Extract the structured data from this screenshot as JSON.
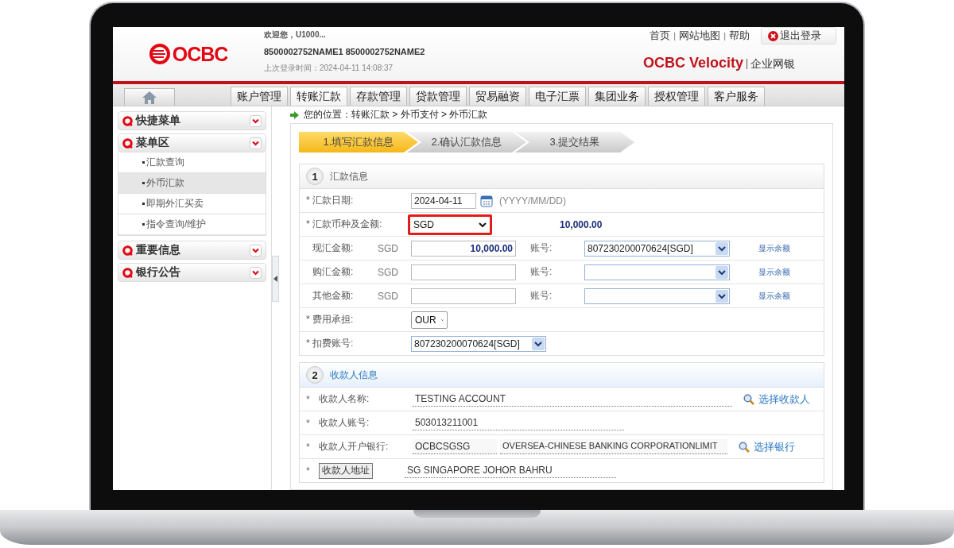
{
  "header": {
    "logo": "OCBC",
    "welcome": "欢迎您，U1000...",
    "names": "8500002752NAME1 8500002752NAME2",
    "last_login": "上次登录时间：2024-04-11 14:08:37",
    "top_links": [
      "首页",
      "网站地图",
      "帮助"
    ],
    "separator": "|",
    "logout": "退出登录",
    "brand": "OCBC Velocity",
    "brand_sub": "企业网银"
  },
  "nav": {
    "tabs": [
      {
        "label": "账户管理",
        "selected": false
      },
      {
        "label": "转账汇款",
        "selected": true
      },
      {
        "label": "存款管理",
        "selected": false
      },
      {
        "label": "贷款管理",
        "selected": false
      },
      {
        "label": "贸易融资",
        "selected": false
      },
      {
        "label": "电子汇票",
        "selected": false
      },
      {
        "label": "集团业务",
        "selected": false
      },
      {
        "label": "授权管理",
        "selected": false
      },
      {
        "label": "客户服务",
        "selected": false
      }
    ]
  },
  "sidebar": {
    "sections": [
      {
        "title": "快捷菜单"
      },
      {
        "title": "菜单区",
        "items": [
          {
            "label": "汇款查询",
            "selected": false
          },
          {
            "label": "外币汇款",
            "selected": true
          },
          {
            "label": "即期外汇买卖",
            "selected": false
          },
          {
            "label": "指令查询/维护",
            "selected": false
          }
        ]
      },
      {
        "title": "重要信息"
      },
      {
        "title": "银行公告"
      }
    ]
  },
  "breadcrumb": "您的位置：转账汇款 > 外币支付 > 外币汇款",
  "steps": [
    {
      "label": "1.填写汇款信息",
      "selected": true
    },
    {
      "label": "2.确认汇款信息",
      "selected": false
    },
    {
      "label": "3.提交结果",
      "selected": false
    }
  ],
  "remittance_section": {
    "number": "1",
    "title": "汇款信息",
    "rows": [
      {
        "kind": "date",
        "label": "* 汇款日期:",
        "value": "2024-04-11",
        "hint": "(YYYY/MM/DD)"
      },
      {
        "kind": "currency",
        "label": "* 汇款币种及金额:",
        "value": "SGD",
        "amount": "10,000.00",
        "highlighted": true
      },
      {
        "kind": "amount",
        "label": "现汇金额:",
        "currency": "SGD",
        "amount": "10,000.00",
        "account_label": "账号:",
        "account": "807230200070624[SGD]",
        "link": "显示余额"
      },
      {
        "kind": "amount",
        "label": "购汇金额:",
        "currency": "SGD",
        "account_label": "账号:",
        "link": "显示余额"
      },
      {
        "kind": "amount",
        "label": "其他金额:",
        "currency": "SGD",
        "account_label": "账号:",
        "link": "显示余额"
      },
      {
        "kind": "select",
        "label": "* 费用承担:",
        "value": "OUR"
      },
      {
        "kind": "combo",
        "label": "* 扣费账号:",
        "value": "807230200070624[SGD]"
      }
    ]
  },
  "payee_section": {
    "number": "2",
    "title": "收款人信息",
    "rows": [
      {
        "kind": "text",
        "mark": "*",
        "label": "收款人名称:",
        "values": [
          "TESTING ACCOUNT"
        ],
        "action": "选择收款人"
      },
      {
        "kind": "text",
        "mark": "*",
        "label": "收款人账号:",
        "values": [
          "503013211001"
        ]
      },
      {
        "kind": "text",
        "mark": "*",
        "label": "收款人开户银行:",
        "values": [
          "OCBCSGSG",
          "OVERSEA-CHINESE BANKING CORPORATIONLIMIT"
        ],
        "action": "选择银行"
      },
      {
        "kind": "button",
        "mark": "*",
        "label": "收款人地址",
        "values": [
          "SG SINGAPORE JOHOR BAHRU"
        ]
      }
    ]
  }
}
